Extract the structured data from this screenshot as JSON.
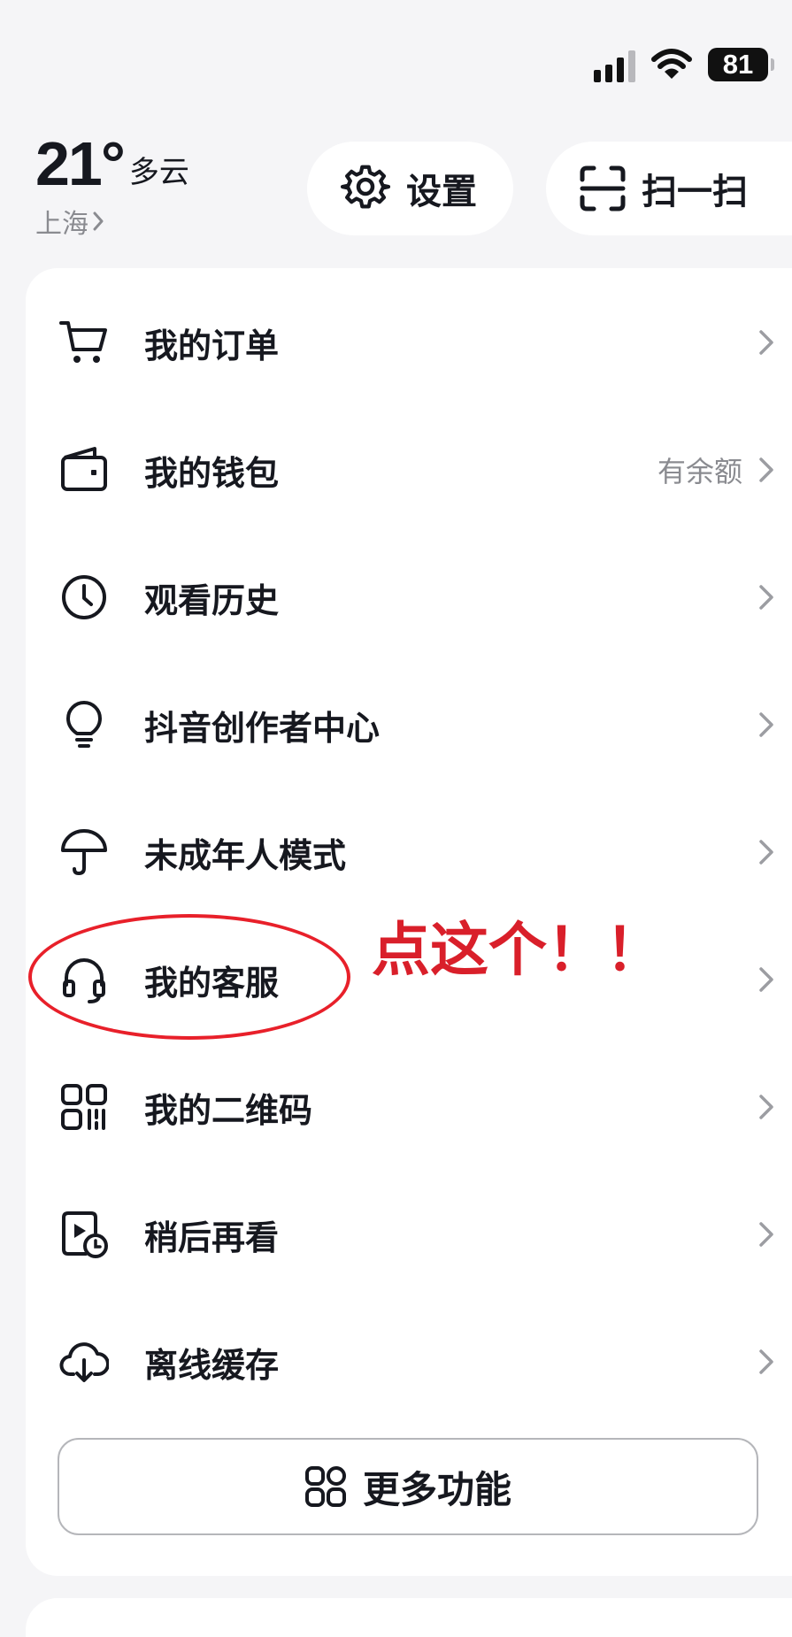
{
  "status": {
    "battery": "81"
  },
  "weather": {
    "temp": "21°",
    "condition": "多云",
    "city": "上海"
  },
  "top_actions": {
    "settings": "设置",
    "scan": "扫一扫"
  },
  "menu": [
    {
      "label": "我的订单",
      "icon": "cart-icon",
      "badge": ""
    },
    {
      "label": "我的钱包",
      "icon": "wallet-icon",
      "badge": "有余额"
    },
    {
      "label": "观看历史",
      "icon": "clock-icon",
      "badge": ""
    },
    {
      "label": "抖音创作者中心",
      "icon": "lightbulb-icon",
      "badge": ""
    },
    {
      "label": "未成年人模式",
      "icon": "umbrella-icon",
      "badge": ""
    },
    {
      "label": "我的客服",
      "icon": "headset-icon",
      "badge": ""
    },
    {
      "label": "我的二维码",
      "icon": "qr-code-icon",
      "badge": ""
    },
    {
      "label": "稍后再看",
      "icon": "watch-later-icon",
      "badge": ""
    },
    {
      "label": "离线缓存",
      "icon": "cloud-download-icon",
      "badge": ""
    }
  ],
  "more_button": "更多功能",
  "annotation": {
    "text": "点这个！！",
    "color": "#d91f2a"
  },
  "colors": {
    "background": "#f5f5f7",
    "text": "#16181f",
    "muted": "#8a8b90",
    "annotation": "#e8202a"
  }
}
